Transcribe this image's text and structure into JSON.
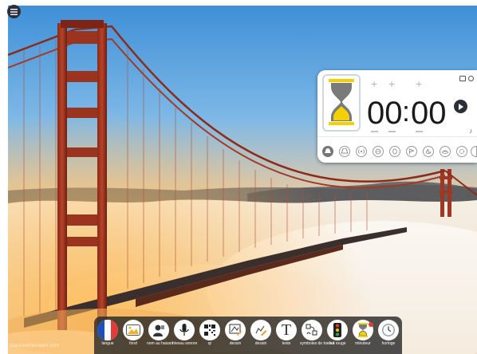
{
  "timer": {
    "minutes": "00",
    "seconds": "00",
    "colon": ":",
    "plus": "+"
  },
  "toolbar": {
    "tools": [
      {
        "key": "langue",
        "label": "langue"
      },
      {
        "key": "fond",
        "label": "fond"
      },
      {
        "key": "nom-au-hasard",
        "label": "nom au hasard"
      },
      {
        "key": "niveau-sonore",
        "label": "niveau sonore"
      },
      {
        "key": "qr",
        "label": "qr"
      },
      {
        "key": "dessin-1",
        "label": "dessin"
      },
      {
        "key": "dessin-2",
        "label": "dessin"
      },
      {
        "key": "texte",
        "label": "texte"
      },
      {
        "key": "symboles-de-travail",
        "label": "symboles de travail"
      },
      {
        "key": "feu-rouge",
        "label": "feu rouge"
      },
      {
        "key": "minuteur",
        "label": "minuteur"
      },
      {
        "key": "horloge",
        "label": "horloge"
      }
    ],
    "texte_glyph": "T"
  },
  "watermark": "classroomscreen.com",
  "colors": {
    "toolbar_bg": "#262626",
    "hourglass_sand": "#f4d000",
    "hourglass_frame": "#7a7a7a",
    "badge": "#e53935"
  },
  "icons": [
    "menu-icon",
    "hourglass-icon",
    "play-icon",
    "sound-icon",
    "music-icon",
    "flag-icon",
    "landscape-icon",
    "person-icon",
    "microphone-icon",
    "qr-icon",
    "pencil-icon",
    "text-icon",
    "symbols-icon",
    "traffic-light-icon",
    "timer-icon",
    "clock-icon"
  ]
}
